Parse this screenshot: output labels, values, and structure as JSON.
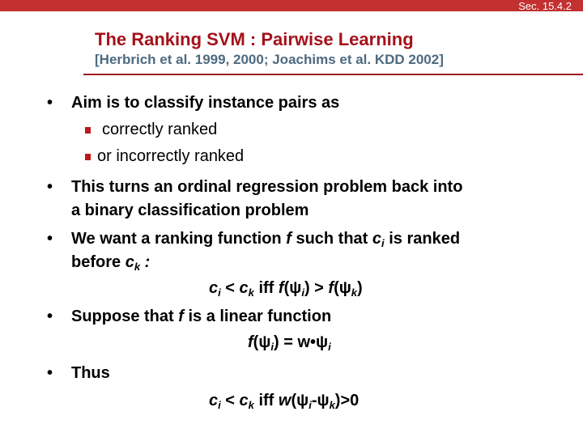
{
  "header": {
    "section": "Sec. 15.4.2",
    "title": "The Ranking SVM : Pairwise Learning",
    "subtitle": "[Herbrich et al. 1999, 2000; Joachims et al. KDD 2002]"
  },
  "bullets": [
    {
      "text": "Aim is to classify instance pairs as",
      "subitems": [
        "correctly ranked",
        "or incorrectly ranked"
      ]
    },
    {
      "line1": "This turns an ordinal regression problem back into",
      "line2": "a binary classification problem"
    },
    {
      "prefix": "We want a ranking function ",
      "f": "f",
      "mid": " such that ",
      "ci": "c",
      "i": "i",
      "suffix": " is ranked",
      "line2_prefix": "before ",
      "ck": "c",
      "k": "k",
      "line2_suffix": " :",
      "formula": {
        "c1": "c",
        "s1": "i",
        "op1": " < ",
        "c2": "c",
        "s2": "k",
        "iff": " iff ",
        "f1": "f",
        "psi1": "(ψ",
        "s3": "i",
        "gt": ") > ",
        "f2": "f",
        "psi2": "(ψ",
        "s4": "k",
        "close": ")"
      }
    },
    {
      "prefix": "Suppose that ",
      "f": "f",
      "suffix": " is a linear function",
      "formula": {
        "f": "f",
        "psi": "(ψ",
        "s1": "i",
        "mid": ") = w•ψ",
        "s2": "i"
      }
    },
    {
      "text": "Thus",
      "formula": {
        "c1": "c",
        "s1": "i",
        "op": " < ",
        "c2": "c",
        "s2": "k",
        "iff": " iff ",
        "w": "w",
        "open": "(ψ",
        "s3": "i",
        "minus": "-ψ",
        "s4": "k",
        "close": ")>0"
      }
    }
  ]
}
